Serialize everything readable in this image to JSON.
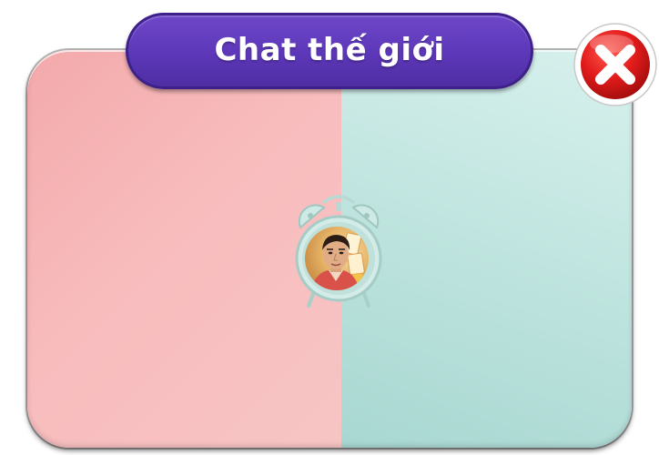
{
  "header": {
    "title": "Chat thế giới"
  },
  "close_button": {
    "icon": "close-icon"
  },
  "content": {
    "alarm_clock": {
      "icon": "alarm-clock-icon"
    },
    "avatar": "avatar"
  },
  "colors": {
    "panel_left": "#f8bcbd",
    "panel_right": "#c2e6e0",
    "banner": "#5c37b8",
    "close_red": "#e21b1b"
  }
}
